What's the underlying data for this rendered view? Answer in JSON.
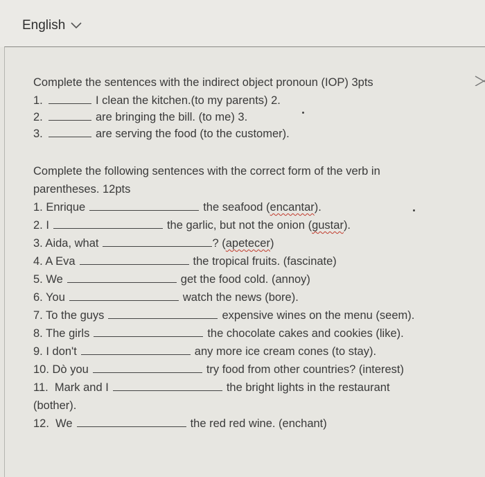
{
  "header": {
    "language": "English"
  },
  "section1": {
    "title": "Complete the sentences with the indirect object pronoun (IOP) 3pts",
    "items": [
      {
        "num": "1.",
        "text": "I clean the kitchen.(to my parents) 2."
      },
      {
        "num": "2.",
        "text": "are bringing the bill. (to me) 3."
      },
      {
        "num": "3.",
        "text": "are serving the food (to the customer)."
      }
    ]
  },
  "section2": {
    "title_line1": "Complete the following sentences with the correct form of the verb in",
    "title_line2": "parentheses. 12pts",
    "items": [
      {
        "prefix": "1. Enrique",
        "suffix": "the seafood ",
        "verb": "encantar",
        "end": ")."
      },
      {
        "prefix": "2. I",
        "suffix": "the garlic, but not the onion ",
        "verb": "gustar",
        "end": ")."
      },
      {
        "prefix": "3. Aida, what",
        "suffix": "? ",
        "verb": "apetecer",
        "end": ")"
      },
      {
        "prefix": "4. A Eva",
        "suffix": "the tropical fruits. (fascinate)"
      },
      {
        "prefix": "5. We",
        "suffix": "get the food cold. (annoy)"
      },
      {
        "prefix": "6. You",
        "suffix": "watch the news (bore)."
      },
      {
        "prefix": "7. To the guys",
        "suffix": "expensive wines on the menu (seem)."
      },
      {
        "prefix": "8. The girls",
        "suffix": "the chocolate cakes and cookies (like)."
      },
      {
        "prefix": "9. I don't",
        "suffix": "any more ice cream cones (to stay)."
      },
      {
        "prefix": "10. Dò you",
        "suffix": "try food from other countries? (interest)"
      },
      {
        "prefix": "11.  Mark and I",
        "suffix": "the bright lights in the restaurant"
      },
      {
        "prefix": "(bother).",
        "suffix": ""
      },
      {
        "prefix": "12.  We",
        "suffix": "the red red wine. (enchant)"
      }
    ]
  }
}
